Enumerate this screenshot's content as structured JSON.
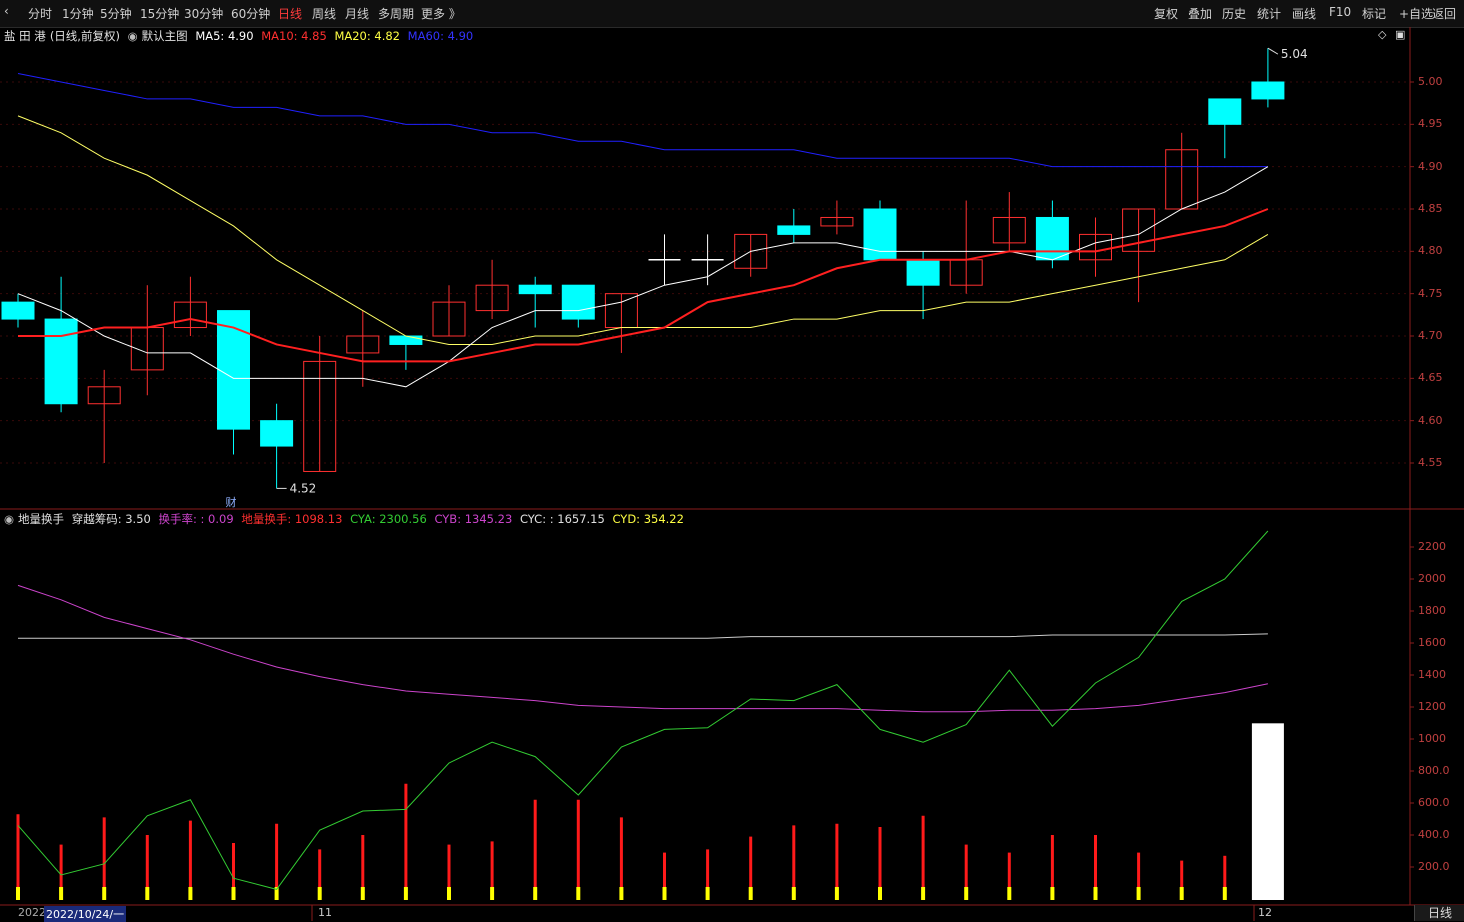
{
  "toolbar": {
    "back_icon": "chevron-left-icon",
    "periods": [
      "分时",
      "1分钟",
      "5分钟",
      "15分钟",
      "30分钟",
      "60分钟",
      "日线",
      "周线",
      "月线",
      "多周期",
      "更多 》"
    ],
    "active_period": "日线",
    "right_items": [
      "复权",
      "叠加",
      "历史",
      "统计",
      "画线",
      "F10",
      "标记",
      "+自选",
      "返回"
    ]
  },
  "main_info": {
    "stock": "盐 田 港",
    "mode": "(日线,前复权)",
    "template": "默认主图",
    "ma5": "MA5: 4.90",
    "ma10": "MA10: 4.85",
    "ma20": "MA20: 4.82",
    "ma60": "MA60: 4.90"
  },
  "indicator_info": {
    "name": "地量换手",
    "chip": "穿越筹码: 3.50",
    "turnover": "换手率: : 0.09",
    "dlhs": "地量换手: 1098.13",
    "cya": "CYA: 2300.56",
    "cyb": "CYB: 1345.23",
    "cyc": "CYC: : 1657.15",
    "cyd": "CYD: 354.22"
  },
  "annotations": {
    "high": "5.04",
    "low": "4.52",
    "finance_mark": "财"
  },
  "colors": {
    "up": "#ff3030",
    "down": "#00ffff",
    "ma5": "#ffffff",
    "ma10": "#ff2020",
    "ma20": "#ffff66",
    "ma60": "#2020ff",
    "cya": "#33cc33",
    "cyb": "#cc44cc",
    "cyc": "#cccccc"
  },
  "chart_data": [
    {
      "type": "candlestick",
      "ylim": [
        4.5,
        5.05
      ],
      "yticks": [
        "5.00",
        "4.95",
        "4.90",
        "4.85",
        "4.80",
        "4.75",
        "4.70",
        "4.65",
        "4.60",
        "4.55"
      ],
      "candles": [
        [
          4.74,
          4.72,
          4.75,
          4.71
        ],
        [
          4.72,
          4.62,
          4.77,
          4.61
        ],
        [
          4.62,
          4.64,
          4.66,
          4.55
        ],
        [
          4.66,
          4.71,
          4.76,
          4.63
        ],
        [
          4.71,
          4.74,
          4.77,
          4.7
        ],
        [
          4.73,
          4.59,
          4.73,
          4.56
        ],
        [
          4.6,
          4.57,
          4.62,
          4.52
        ],
        [
          4.54,
          4.67,
          4.7,
          4.54
        ],
        [
          4.68,
          4.7,
          4.73,
          4.64
        ],
        [
          4.7,
          4.69,
          4.7,
          4.66
        ],
        [
          4.7,
          4.74,
          4.76,
          4.7
        ],
        [
          4.73,
          4.76,
          4.79,
          4.72
        ],
        [
          4.76,
          4.75,
          4.77,
          4.71
        ],
        [
          4.76,
          4.72,
          4.76,
          4.71
        ],
        [
          4.71,
          4.75,
          4.75,
          4.68
        ],
        [
          4.79,
          4.79,
          4.82,
          4.76
        ],
        [
          4.79,
          4.79,
          4.82,
          4.76
        ],
        [
          4.78,
          4.82,
          4.82,
          4.77
        ],
        [
          4.83,
          4.82,
          4.85,
          4.81
        ],
        [
          4.83,
          4.84,
          4.86,
          4.82
        ],
        [
          4.85,
          4.79,
          4.86,
          4.79
        ],
        [
          4.79,
          4.76,
          4.8,
          4.72
        ],
        [
          4.76,
          4.79,
          4.86,
          4.75
        ],
        [
          4.81,
          4.84,
          4.87,
          4.8
        ],
        [
          4.84,
          4.79,
          4.86,
          4.78
        ],
        [
          4.79,
          4.82,
          4.84,
          4.77
        ],
        [
          4.8,
          4.85,
          4.85,
          4.74
        ],
        [
          4.85,
          4.92,
          4.94,
          4.85
        ],
        [
          4.98,
          4.95,
          4.98,
          4.91
        ],
        [
          5.0,
          4.98,
          5.04,
          4.97
        ]
      ],
      "ma5": [
        4.75,
        4.73,
        4.7,
        4.68,
        4.68,
        4.65,
        4.65,
        4.65,
        4.65,
        4.64,
        4.67,
        4.71,
        4.73,
        4.73,
        4.74,
        4.76,
        4.77,
        4.8,
        4.81,
        4.81,
        4.8,
        4.8,
        4.8,
        4.8,
        4.79,
        4.81,
        4.82,
        4.85,
        4.87,
        4.9
      ],
      "ma10": [
        4.7,
        4.7,
        4.71,
        4.71,
        4.72,
        4.71,
        4.69,
        4.68,
        4.67,
        4.67,
        4.67,
        4.68,
        4.69,
        4.69,
        4.7,
        4.71,
        4.74,
        4.75,
        4.76,
        4.78,
        4.79,
        4.79,
        4.79,
        4.8,
        4.8,
        4.8,
        4.81,
        4.82,
        4.83,
        4.85
      ],
      "ma20": [
        4.96,
        4.94,
        4.91,
        4.89,
        4.86,
        4.83,
        4.79,
        4.76,
        4.73,
        4.7,
        4.69,
        4.69,
        4.7,
        4.7,
        4.71,
        4.71,
        4.71,
        4.71,
        4.72,
        4.72,
        4.73,
        4.73,
        4.74,
        4.74,
        4.75,
        4.76,
        4.77,
        4.78,
        4.79,
        4.82
      ],
      "ma60": [
        5.01,
        5.0,
        4.99,
        4.98,
        4.98,
        4.97,
        4.97,
        4.96,
        4.96,
        4.95,
        4.95,
        4.94,
        4.94,
        4.93,
        4.93,
        4.92,
        4.92,
        4.92,
        4.92,
        4.91,
        4.91,
        4.91,
        4.91,
        4.91,
        4.9,
        4.9,
        4.9,
        4.9,
        4.9,
        4.9
      ]
    },
    {
      "type": "line",
      "ylim": [
        0,
        2350
      ],
      "yticks": [
        "2200",
        "2000",
        "1800",
        "1600",
        "1400",
        "1200",
        "1000",
        "800.0",
        "600.0",
        "400.0",
        "200.0"
      ],
      "cya": [
        460,
        150,
        220,
        520,
        620,
        130,
        60,
        430,
        550,
        560,
        850,
        980,
        890,
        650,
        950,
        1060,
        1070,
        1250,
        1240,
        1340,
        1060,
        980,
        1090,
        1430,
        1080,
        1350,
        1510,
        1860,
        2000,
        2300
      ],
      "cyb": [
        1960,
        1870,
        1760,
        1690,
        1620,
        1530,
        1450,
        1390,
        1340,
        1300,
        1280,
        1260,
        1240,
        1210,
        1200,
        1190,
        1190,
        1190,
        1190,
        1190,
        1180,
        1170,
        1170,
        1180,
        1180,
        1190,
        1210,
        1250,
        1290,
        1345
      ],
      "cyc": [
        1630,
        1630,
        1630,
        1630,
        1630,
        1630,
        1630,
        1630,
        1630,
        1630,
        1630,
        1630,
        1630,
        1630,
        1630,
        1630,
        1630,
        1640,
        1640,
        1640,
        1640,
        1640,
        1640,
        1640,
        1650,
        1650,
        1650,
        1650,
        1650,
        1657
      ],
      "bars": [
        530,
        340,
        510,
        400,
        490,
        350,
        470,
        310,
        400,
        720,
        340,
        360,
        620,
        620,
        510,
        290,
        310,
        390,
        460,
        470,
        450,
        520,
        340,
        290,
        400,
        400,
        290,
        240,
        270,
        1098
      ],
      "xlabels": [
        "2022",
        "2022/10/24/一",
        "11",
        "12"
      ]
    }
  ],
  "status": {
    "bottom_tab": "日线"
  }
}
